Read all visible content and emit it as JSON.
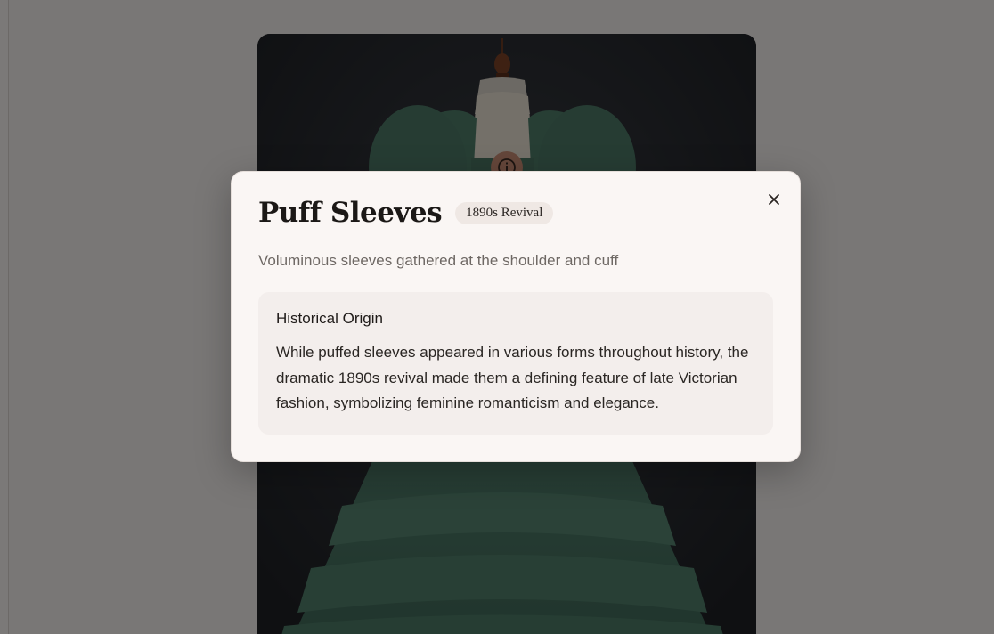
{
  "modal": {
    "title": "Puff Sleeves",
    "badge": "1890s Revival",
    "subtitle": "Voluminous sleeves gathered at the shoulder and cuff",
    "section_heading": "Historical Origin",
    "section_text": "While puffed sleeves appeared in various forms throughout history, the dramatic 1890s revival made them a defining feature of late Victorian fashion, symbolizing feminine romanticism and elegance."
  },
  "icons": {
    "close": "close-icon",
    "info_hotspot": "info-icon"
  },
  "colors": {
    "dress": "#4f7d6a",
    "backdrop": "#25272c",
    "modal_bg": "#faf6f4",
    "badge_bg": "#efe8e4"
  }
}
